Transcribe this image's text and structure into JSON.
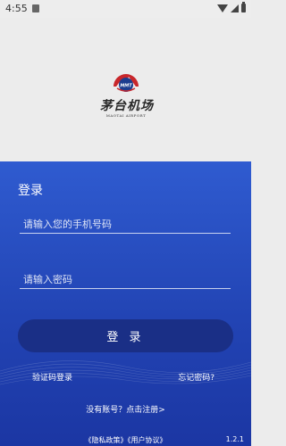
{
  "status_bar": {
    "time": "4:55",
    "icons": [
      "notification-icon",
      "wifi-icon",
      "signal-icon",
      "battery-icon"
    ]
  },
  "logo": {
    "emblem_text": "MMT",
    "name_cn": "茅台机场",
    "name_en": "MAOTAI AIRPORT",
    "colors": {
      "red": "#c8262b",
      "navy": "#1c3d8f"
    }
  },
  "login": {
    "title": "登录",
    "phone_placeholder": "请输入您的手机号码",
    "password_placeholder": "请输入密码",
    "submit_label": "登 录",
    "sms_login_label": "验证码登录",
    "forgot_password_label": "忘记密码?",
    "register_label": "没有账号？点击注册>",
    "privacy_label": "《隐私政策》",
    "terms_label": "《用户协议》",
    "version": "1.2.1"
  },
  "colors": {
    "panel_top": "#2f5bd0",
    "panel_bottom": "#1b36a3",
    "button": "#1a2f86",
    "background": "#ececec"
  }
}
